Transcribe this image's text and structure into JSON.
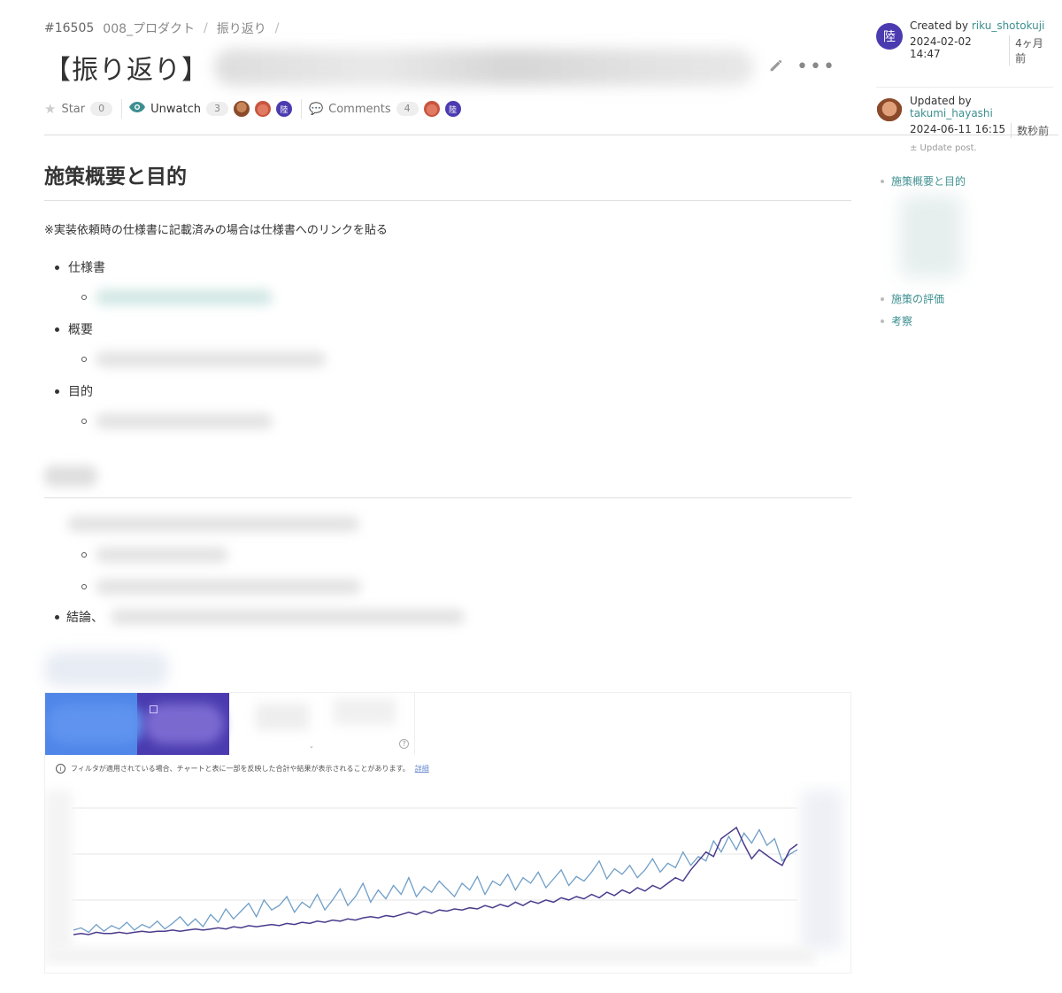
{
  "breadcrumb": {
    "id": "#16505",
    "category": "008_プロダクト",
    "sub": "振り返り"
  },
  "title": {
    "prefix": "【振り返り】"
  },
  "actions": {
    "edit_icon": "pencil-icon",
    "more": "•••"
  },
  "meta": {
    "star_label": "Star",
    "star_count": "0",
    "watch_label": "Unwatch",
    "watch_count": "3",
    "comments_label": "Comments",
    "comments_count": "4",
    "avatar_riku": "陸"
  },
  "author": {
    "created_label": "Created by",
    "created_user": "riku_shotokuji",
    "created_at": "2024-02-02 14:47",
    "created_ago": "4ヶ月前",
    "avatar": "陸",
    "updated_label": "Updated by",
    "updated_user": "takumi_hayashi",
    "updated_at": "2024-06-11 16:15",
    "updated_ago": "数秒前",
    "update_post": "± Update post."
  },
  "toc": {
    "items": [
      "施策概要と目的",
      "施策の評価",
      "考察"
    ]
  },
  "section1": {
    "heading": "施策概要と目的",
    "note": "※実装依頼時の仕様書に記載済みの場合は仕様書へのリンクを貼る",
    "bullets": [
      "仕様書",
      "概要",
      "目的"
    ]
  },
  "section2": {
    "conclusion_prefix": "結論、"
  },
  "chart": {
    "notice": "フィルタが適用されている場合、チャートと表に一部を反映した合計や結果が表示されることがあります。",
    "notice_link": "詳細",
    "help": "?"
  },
  "colors": {
    "link": "#3d8f8f",
    "series_a": "#6f9ec7",
    "series_b": "#4b3b8c",
    "tile_blue": "#4f86e8",
    "tile_purple": "#4a3bb0"
  },
  "chart_data": {
    "type": "line",
    "series": [
      {
        "values": [
          0.08,
          0.1,
          0.06,
          0.13,
          0.07,
          0.12,
          0.09,
          0.15,
          0.08,
          0.13,
          0.1,
          0.16,
          0.09,
          0.14,
          0.2,
          0.12,
          0.18,
          0.11,
          0.22,
          0.15,
          0.27,
          0.18,
          0.25,
          0.32,
          0.2,
          0.35,
          0.26,
          0.3,
          0.38,
          0.24,
          0.33,
          0.28,
          0.4,
          0.26,
          0.35,
          0.45,
          0.3,
          0.38,
          0.5,
          0.33,
          0.44,
          0.36,
          0.48,
          0.4,
          0.55,
          0.38,
          0.47,
          0.42,
          0.52,
          0.45,
          0.38,
          0.5,
          0.44,
          0.56,
          0.4,
          0.52,
          0.48,
          0.58,
          0.44,
          0.55,
          0.5,
          0.6,
          0.46,
          0.54,
          0.62,
          0.48,
          0.56,
          0.52,
          0.6,
          0.7,
          0.54,
          0.63,
          0.58,
          0.66,
          0.55,
          0.62,
          0.72,
          0.6,
          0.68,
          0.64,
          0.78,
          0.66,
          0.74,
          0.7,
          0.88,
          0.78,
          0.92,
          0.8,
          0.95,
          0.86,
          0.98,
          0.84,
          0.9,
          0.7,
          0.76,
          0.8
        ]
      },
      {
        "values": [
          0.04,
          0.05,
          0.04,
          0.06,
          0.05,
          0.05,
          0.06,
          0.05,
          0.06,
          0.07,
          0.06,
          0.07,
          0.07,
          0.08,
          0.07,
          0.08,
          0.09,
          0.08,
          0.09,
          0.1,
          0.09,
          0.11,
          0.1,
          0.12,
          0.11,
          0.12,
          0.13,
          0.12,
          0.14,
          0.13,
          0.15,
          0.14,
          0.16,
          0.15,
          0.17,
          0.16,
          0.18,
          0.17,
          0.19,
          0.2,
          0.19,
          0.21,
          0.2,
          0.22,
          0.24,
          0.22,
          0.25,
          0.23,
          0.26,
          0.25,
          0.27,
          0.26,
          0.28,
          0.27,
          0.3,
          0.28,
          0.31,
          0.29,
          0.33,
          0.3,
          0.34,
          0.32,
          0.35,
          0.33,
          0.37,
          0.35,
          0.38,
          0.36,
          0.4,
          0.37,
          0.42,
          0.39,
          0.44,
          0.41,
          0.46,
          0.43,
          0.48,
          0.45,
          0.5,
          0.55,
          0.52,
          0.62,
          0.7,
          0.78,
          0.74,
          0.9,
          0.95,
          1.0,
          0.85,
          0.72,
          0.8,
          0.75,
          0.7,
          0.66,
          0.8,
          0.85
        ]
      }
    ]
  }
}
